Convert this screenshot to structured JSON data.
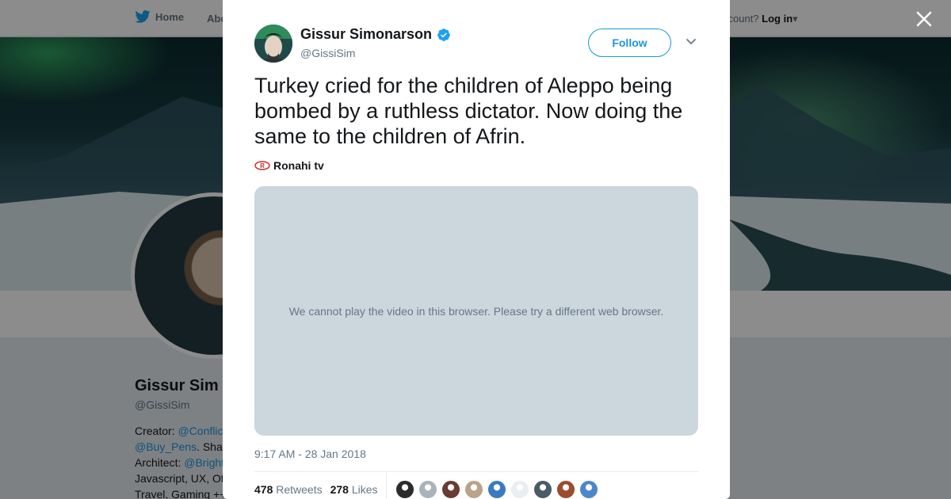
{
  "nav": {
    "home_label": "Home",
    "about_label": "Abo",
    "account_prompt": "ccount?",
    "login_label": "Log in"
  },
  "background_profile": {
    "name": "Gissur Sim",
    "handle": "@GissiSim",
    "bio_lines": [
      {
        "text": "Creator: ",
        "link": "@Conflic"
      },
      {
        "text": "",
        "link": "@Buy_Pens",
        "after": ". Sha"
      },
      {
        "text": "Architect: ",
        "link": "@Bright"
      },
      {
        "text": "Javascript, UX, Ot",
        "link": ""
      },
      {
        "text": "Travel, Gaming ++",
        "link": ""
      }
    ]
  },
  "tweet": {
    "author_name": "Gissur Simonarson",
    "author_handle": "@GissiSim",
    "verified": true,
    "follow_label": "Follow",
    "text": "Turkey cried for the children of Aleppo being bombed by a ruthless dictator. Now doing the same to the children of Afrin.",
    "source_name": "Ronahi tv",
    "video_message": "We cannot play the video in this browser. Please try a different web browser.",
    "timestamp": "9:17 AM - 28 Jan 2018",
    "retweets_count": "478",
    "retweets_label": "Retweets",
    "likes_count": "278",
    "likes_label": "Likes",
    "liker_avatar_colors": [
      "#2b2b2b",
      "#a9b3ba",
      "#6a3a33",
      "#b9a48a",
      "#3a7bbf",
      "#e9eef2",
      "#4a5b66",
      "#9c4b2c",
      "#4e87c9"
    ]
  },
  "colors": {
    "twitter_blue": "#1b95e0",
    "verified_blue": "#1da1f2",
    "video_placeholder": "#ccd6dd",
    "muted_text": "#657786"
  },
  "icons": [
    "twitter-bird-icon",
    "close-icon",
    "verified-badge-icon",
    "chevron-down-icon",
    "ronahi-logo-icon"
  ]
}
